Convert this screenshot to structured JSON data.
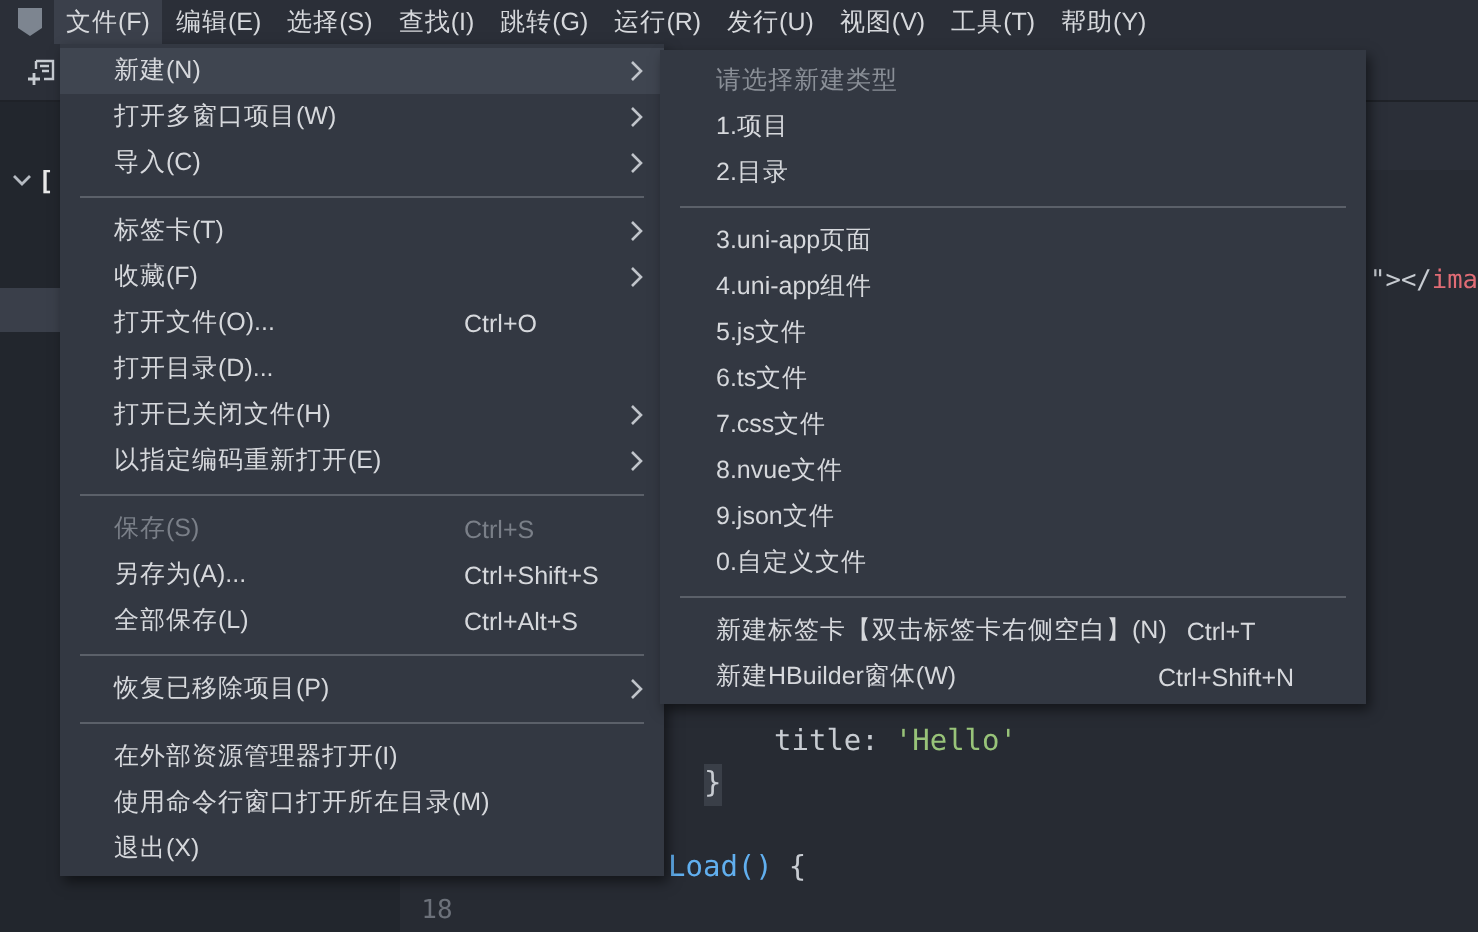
{
  "menu_bar": [
    {
      "label": "文件(F)",
      "selected": true
    },
    {
      "label": "编辑(E)",
      "selected": false
    },
    {
      "label": "选择(S)",
      "selected": false
    },
    {
      "label": "查找(I)",
      "selected": false
    },
    {
      "label": "跳转(G)",
      "selected": false
    },
    {
      "label": "运行(R)",
      "selected": false
    },
    {
      "label": "发行(U)",
      "selected": false
    },
    {
      "label": "视图(V)",
      "selected": false
    },
    {
      "label": "工具(T)",
      "selected": false
    },
    {
      "label": "帮助(Y)",
      "selected": false
    }
  ],
  "sidebar": {
    "tree_fragment": "["
  },
  "editor": {
    "lines": [
      {
        "kind": "tail",
        "tokens": [
          {
            "kind": "punct",
            "text": "\"></"
          },
          {
            "kind": "tag",
            "text": "ima"
          }
        ]
      },
      {
        "kind": "code"
      },
      {
        "kind": "code"
      },
      {
        "kind": "code"
      },
      {
        "kind": "code"
      },
      {
        "kind": "code"
      },
      {
        "kind": "code"
      },
      {
        "kind": "code"
      },
      {
        "kind": "code"
      },
      {
        "kind": "code"
      },
      {
        "kind": "code"
      },
      {
        "kind": "property",
        "tokens": [
          {
            "kind": "plain",
            "text": "title:"
          },
          {
            "kind": "string",
            "text": "'Hello'"
          }
        ]
      },
      {
        "kind": "statement",
        "tokens": [
          {
            "kind": "brace",
            "text": "}"
          }
        ]
      },
      {
        "kind": "code"
      },
      {
        "kind": "method",
        "tokens": [
          {
            "kind": "func",
            "text": "Load()"
          },
          {
            "kind": "plain",
            "text": "{"
          }
        ]
      },
      {
        "kind": "code",
        "number": "18"
      }
    ]
  },
  "file_menu": [
    {
      "kind": "item",
      "label": "新建(N)",
      "submenu": true,
      "selected": true,
      "disabled": false
    },
    {
      "kind": "item",
      "label": "打开多窗口项目(W)",
      "submenu": true,
      "selected": false,
      "disabled": false
    },
    {
      "kind": "item",
      "label": "导入(C)",
      "submenu": true,
      "selected": false,
      "disabled": false
    },
    {
      "kind": "separator"
    },
    {
      "kind": "item",
      "label": "标签卡(T)",
      "submenu": true,
      "selected": false,
      "disabled": false
    },
    {
      "kind": "item",
      "label": "收藏(F)",
      "submenu": true,
      "selected": false,
      "disabled": false
    },
    {
      "kind": "item",
      "label": "打开文件(O)...",
      "shortcut": "Ctrl+O",
      "submenu": false,
      "selected": false,
      "disabled": false
    },
    {
      "kind": "item",
      "label": "打开目录(D)...",
      "submenu": false,
      "selected": false,
      "disabled": false
    },
    {
      "kind": "item",
      "label": "打开已关闭文件(H)",
      "submenu": true,
      "selected": false,
      "disabled": false
    },
    {
      "kind": "item",
      "label": "以指定编码重新打开(E)",
      "submenu": true,
      "selected": false,
      "disabled": false
    },
    {
      "kind": "separator"
    },
    {
      "kind": "item",
      "label": "保存(S)",
      "shortcut": "Ctrl+S",
      "submenu": false,
      "selected": false,
      "disabled": true
    },
    {
      "kind": "item",
      "label": "另存为(A)...",
      "shortcut": "Ctrl+Shift+S",
      "submenu": false,
      "selected": false,
      "disabled": false
    },
    {
      "kind": "item",
      "label": "全部保存(L)",
      "shortcut": "Ctrl+Alt+S",
      "submenu": false,
      "selected": false,
      "disabled": false
    },
    {
      "kind": "separator"
    },
    {
      "kind": "item",
      "label": "恢复已移除项目(P)",
      "submenu": true,
      "selected": false,
      "disabled": false
    },
    {
      "kind": "separator"
    },
    {
      "kind": "item",
      "label": "在外部资源管理器打开(I)",
      "submenu": false,
      "selected": false,
      "disabled": false
    },
    {
      "kind": "item",
      "label": "使用命令行窗口打开所在目录(M)",
      "submenu": false,
      "selected": false,
      "disabled": false
    },
    {
      "kind": "item",
      "label": "退出(X)",
      "submenu": false,
      "selected": false,
      "disabled": false
    }
  ],
  "new_submenu": [
    {
      "kind": "header",
      "label": "请选择新建类型"
    },
    {
      "kind": "item",
      "label": "1.项目",
      "selected": false
    },
    {
      "kind": "item",
      "label": "2.目录",
      "selected": false
    },
    {
      "kind": "separator"
    },
    {
      "kind": "item",
      "label": "3.uni-app页面",
      "selected": false
    },
    {
      "kind": "item",
      "label": "4.uni-app组件",
      "selected": false
    },
    {
      "kind": "item",
      "label": "5.js文件",
      "selected": false
    },
    {
      "kind": "item",
      "label": "6.ts文件",
      "selected": false
    },
    {
      "kind": "item",
      "label": "7.css文件",
      "selected": false
    },
    {
      "kind": "item",
      "label": "8.nvue文件",
      "selected": false
    },
    {
      "kind": "item",
      "label": "9.json文件",
      "selected": false
    },
    {
      "kind": "item",
      "label": "0.自定义文件",
      "selected": false
    },
    {
      "kind": "separator"
    },
    {
      "kind": "item",
      "label": "新建标签卡【双击标签卡右侧空白】(N)",
      "shortcut": "Ctrl+T",
      "selected": false
    },
    {
      "kind": "item",
      "label": "新建HBuilder窗体(W)",
      "shortcut": "Ctrl+Shift+N",
      "selected": false
    }
  ]
}
